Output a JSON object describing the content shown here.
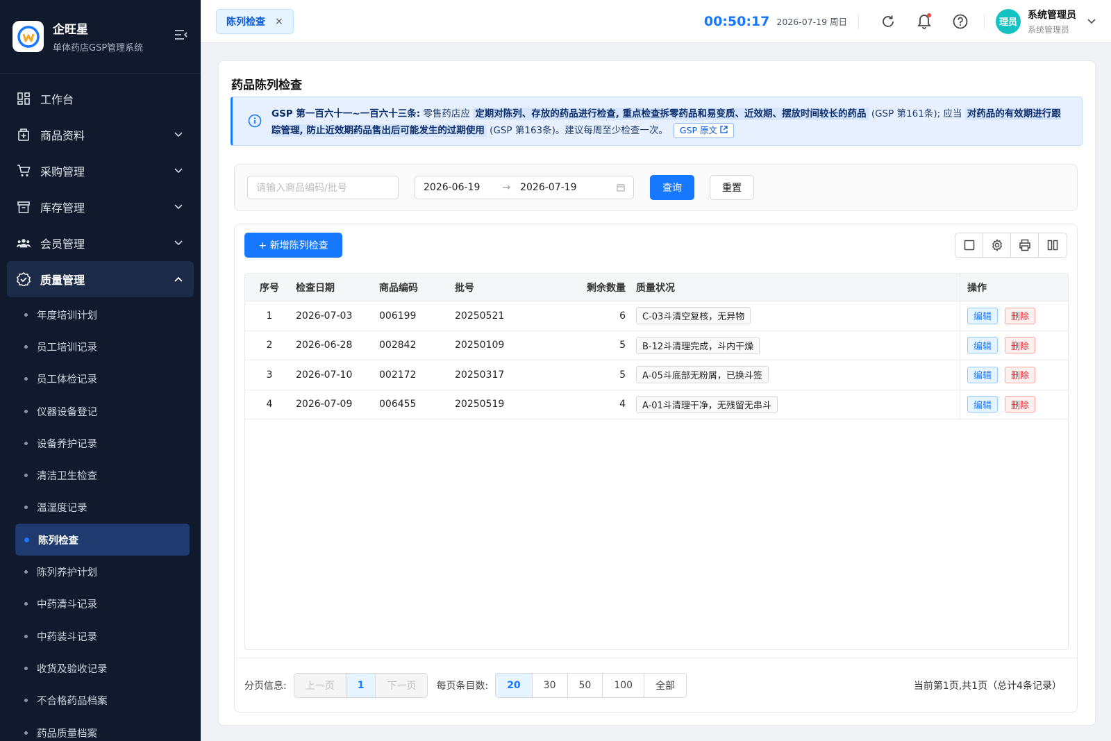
{
  "brand": {
    "name": "企旺星",
    "subtitle": "单体药店GSP管理系统"
  },
  "menu": [
    {
      "label": "工作台"
    },
    {
      "label": "商品资料"
    },
    {
      "label": "采购管理"
    },
    {
      "label": "库存管理"
    },
    {
      "label": "会员管理"
    },
    {
      "label": "质量管理"
    }
  ],
  "submenu": [
    {
      "label": "年度培训计划"
    },
    {
      "label": "员工培训记录"
    },
    {
      "label": "员工体检记录"
    },
    {
      "label": "仪器设备登记"
    },
    {
      "label": "设备养护记录"
    },
    {
      "label": "清洁卫生检查"
    },
    {
      "label": "温湿度记录"
    },
    {
      "label": "陈列检查"
    },
    {
      "label": "陈列养护计划"
    },
    {
      "label": "中药清斗记录"
    },
    {
      "label": "中药装斗记录"
    },
    {
      "label": "收货及验收记录"
    },
    {
      "label": "不合格药品档案"
    },
    {
      "label": "药品质量档案"
    }
  ],
  "topbar": {
    "tab_label": "陈列检查",
    "tab_close": "×",
    "clock": "00:50:17",
    "date": "2026-07-19 周日",
    "user_avatar": "理员",
    "user_name": "系统管理员",
    "user_role": "系统管理员"
  },
  "page": {
    "title": "药品陈列检查",
    "alert": {
      "lead": "GSP 第一百六十一~一百六十三条:",
      "t1": " 零售药店应 ",
      "h1": "定期对陈列、存放的药品进行检查, 重点检查拆零药品和易变质、近效期、摆放时间较长的药品",
      "t2": " (GSP 第161条); 应当 ",
      "h2": "对药品的有效期进行跟踪管理, 防止近效期药品售出后可能发生的过期使用",
      "t3": " (GSP 第163条)。建议每周至少检查一次。",
      "link": "GSP 原文"
    }
  },
  "filter": {
    "search_placeholder": "请输入商品编码/批号",
    "date_start": "2026-06-19",
    "date_sep": "→",
    "date_end": "2026-07-19",
    "query_label": "查询",
    "reset_label": "重置"
  },
  "toolbar": {
    "add_label": "+ 新增陈列检查"
  },
  "table": {
    "headers": {
      "idx": "序号",
      "date": "检查日期",
      "code": "商品编码",
      "batch": "批号",
      "qty": "剩余数量",
      "status": "质量状况",
      "op": "操作"
    },
    "edit_label": "编辑",
    "delete_label": "删除",
    "rows": [
      {
        "idx": "1",
        "date": "2026-07-03",
        "code": "006199",
        "batch": "20250521",
        "qty": "6",
        "status": "C-03斗清空复核，无异物"
      },
      {
        "idx": "2",
        "date": "2026-06-28",
        "code": "002842",
        "batch": "20250109",
        "qty": "5",
        "status": "B-12斗清理完成，斗内干燥"
      },
      {
        "idx": "3",
        "date": "2026-07-10",
        "code": "002172",
        "batch": "20250317",
        "qty": "5",
        "status": "A-05斗底部无粉屑，已换斗签"
      },
      {
        "idx": "4",
        "date": "2026-07-09",
        "code": "006455",
        "batch": "20250519",
        "qty": "4",
        "status": "A-01斗清理干净，无残留无串斗"
      }
    ]
  },
  "pager": {
    "label": "分页信息:",
    "prev": "上一页",
    "current": "1",
    "next": "下一页",
    "size_label": "每页条目数:",
    "sizes": [
      "20",
      "30",
      "50",
      "100",
      "全部"
    ],
    "selected_size": "20",
    "info": "当前第1页,共1页（总计4条记录）"
  }
}
